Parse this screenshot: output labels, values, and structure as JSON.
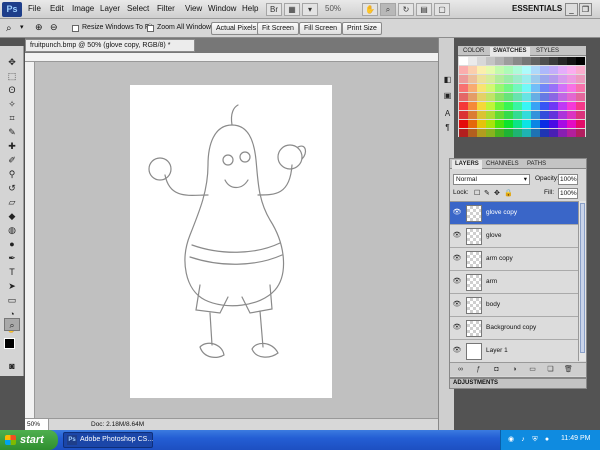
{
  "menubar": {
    "logo": "Ps",
    "items": [
      "File",
      "Edit",
      "Image",
      "Layer",
      "Select",
      "Filter",
      "View",
      "Window",
      "Help"
    ],
    "zoom_display": "50%",
    "workspace": "ESSENTIALS"
  },
  "options_bar": {
    "resize_windows_label": "Resize Windows To Fit",
    "zoom_all_label": "Zoom All Windows",
    "actual_pixels": "Actual Pixels",
    "fit_screen": "Fit Screen",
    "fill_screen": "Fill Screen",
    "print_size": "Print Size"
  },
  "document": {
    "tab_title": "fruitpunch.bmp @ 50% (glove copy, RGB/8) *",
    "zoom": "50%",
    "doc_info": "Doc: 2.18M/8.64M"
  },
  "swatches_panel": {
    "tabs": [
      "COLOR",
      "SWATCHES",
      "STYLES"
    ],
    "active_tab": "SWATCHES"
  },
  "layers_panel": {
    "tabs": [
      "LAYERS",
      "CHANNELS",
      "PATHS"
    ],
    "active_tab": "LAYERS",
    "blend_mode": "Normal",
    "opacity_label": "Opacity:",
    "opacity": "100%",
    "lock_label": "Lock:",
    "fill_label": "Fill:",
    "fill": "100%",
    "layers": [
      {
        "name": "glove copy",
        "selected": true
      },
      {
        "name": "glove",
        "selected": false
      },
      {
        "name": "arm copy",
        "selected": false
      },
      {
        "name": "arm",
        "selected": false
      },
      {
        "name": "body",
        "selected": false
      },
      {
        "name": "Background copy",
        "selected": false
      },
      {
        "name": "Layer 1",
        "selected": false
      }
    ]
  },
  "adjustments_panel": {
    "title": "ADJUSTMENTS"
  },
  "taskbar": {
    "start_label": "start",
    "task_label": "Adobe Photoshop CS...",
    "clock": "11:49 PM"
  },
  "colors": {
    "selection_blue": "#3a66c8",
    "taskbar_blue": "#245ed4",
    "start_green": "#2f8f2f"
  }
}
